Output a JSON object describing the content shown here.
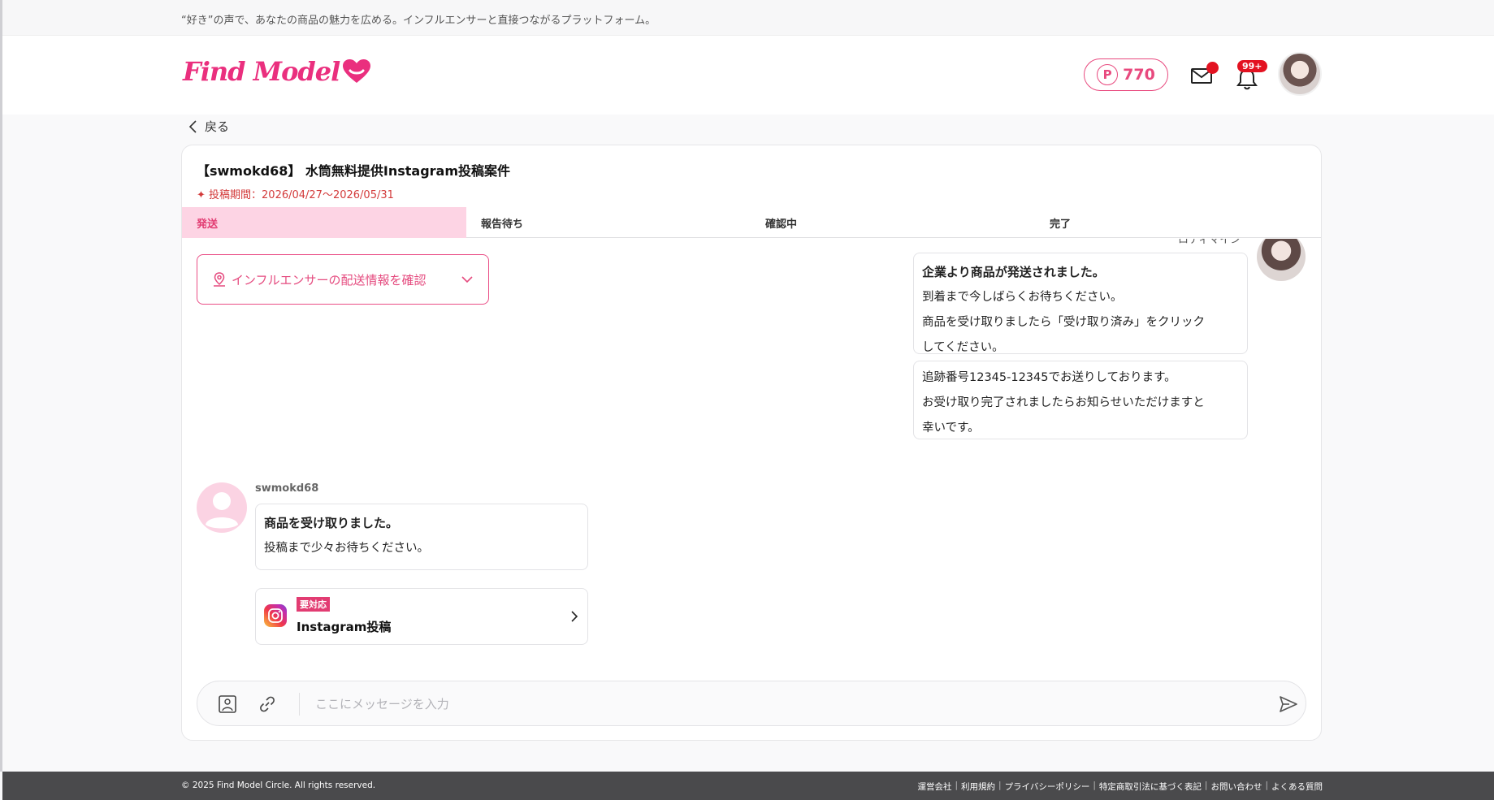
{
  "topbar": {
    "tagline": "“好き”の声で、あなたの商品の魅力を広める。インフルエンサーと直接つながるプラットフォーム。"
  },
  "header": {
    "logo_text": "Find Model",
    "points_badge": "P",
    "points_value": "770",
    "notification_count": "99+"
  },
  "nav": {
    "back_label": "戻る"
  },
  "campaign": {
    "title": "【swmokd68】 水筒無料提供Instagram投稿案件",
    "period": "✦ 投稿期間：2026/04/27〜2026/05/31"
  },
  "tabs": [
    {
      "label": "発送"
    },
    {
      "label": "報告待ち"
    },
    {
      "label": "確認中"
    },
    {
      "label": "完了"
    }
  ],
  "chat": {
    "shipping_info_label": "インフルエンサーの配送情報を確認",
    "company_name": "ロティマイン",
    "company_msg1": {
      "title": "企業より商品が発送されました。",
      "line1": "到着まで今しばらくお待ちください。",
      "line2": "商品を受け取りましたら「受け取り済み」をクリック",
      "line3": "してください。"
    },
    "company_msg2": {
      "line1": "追跡番号12345-12345でお送りしております。",
      "line2": "お受け取り完了されましたらお知らせいただけますと",
      "line3": "幸いです。"
    },
    "user_name": "swmokd68",
    "user_msg": {
      "title": "商品を受け取りました。",
      "line1": "投稿まで少々お待ちください。"
    },
    "task": {
      "badge": "要対応",
      "label": "Instagram投稿"
    }
  },
  "composer": {
    "placeholder": "ここにメッセージを入力"
  },
  "footer": {
    "copyright": "© 2025 Find Model Circle. All rights reserved.",
    "links": [
      "運営会社",
      "利用規約",
      "プライバシーポリシー",
      "特定商取引法に基づく表記",
      "お問い合わせ",
      "よくある質問"
    ]
  },
  "colors": {
    "brand_pink": "#ea2f7e",
    "active_tab_bg": "#fdd4e4",
    "badge_red": "#e31221",
    "footer_bg": "#4a4a4c"
  }
}
